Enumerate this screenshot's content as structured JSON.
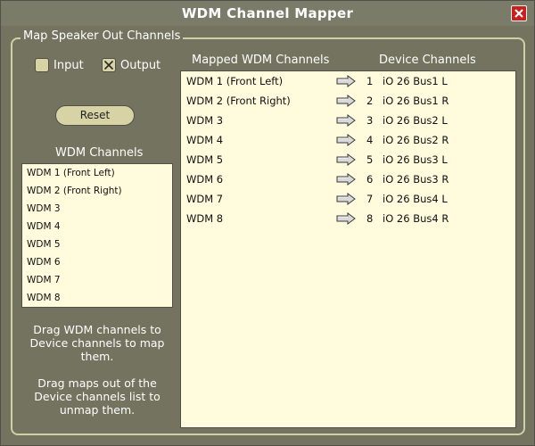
{
  "window": {
    "title": "WDM Channel Mapper"
  },
  "group": {
    "title": "Map Speaker Out Channels"
  },
  "direction": {
    "input_label": "Input",
    "output_label": "Output",
    "input_checked": false,
    "output_checked": true
  },
  "reset_label": "Reset",
  "wdm_channels": {
    "label": "WDM Channels",
    "items": [
      "WDM 1 (Front Left)",
      "WDM 2 (Front Right)",
      "WDM 3",
      "WDM 4",
      "WDM 5",
      "WDM 6",
      "WDM 7",
      "WDM 8"
    ]
  },
  "instructions": {
    "line1": "Drag WDM channels to Device channels to map them.",
    "line2": "Drag maps out of the Device channels list to unmap them."
  },
  "mappings": {
    "col_wdm": "Mapped WDM Channels",
    "col_device": "Device Channels",
    "rows": [
      {
        "wdm": "WDM 1 (Front Left)",
        "num": "1",
        "device": "iO 26 Bus1 L"
      },
      {
        "wdm": "WDM 2 (Front Right)",
        "num": "2",
        "device": "iO 26 Bus1 R"
      },
      {
        "wdm": "WDM 3",
        "num": "3",
        "device": "iO 26 Bus2 L"
      },
      {
        "wdm": "WDM 4",
        "num": "4",
        "device": "iO 26 Bus2 R"
      },
      {
        "wdm": "WDM 5",
        "num": "5",
        "device": "iO 26 Bus3 L"
      },
      {
        "wdm": "WDM 6",
        "num": "6",
        "device": "iO 26 Bus3 R"
      },
      {
        "wdm": "WDM 7",
        "num": "7",
        "device": "iO 26 Bus4 L"
      },
      {
        "wdm": "WDM 8",
        "num": "8",
        "device": "iO 26 Bus4 R"
      }
    ]
  },
  "colors": {
    "background": "#73735f",
    "list_bg": "#fffbdc",
    "accent": "#d8d3a4",
    "close": "#c8201c"
  },
  "icons": {
    "close": "close-icon",
    "check": "x-check-icon",
    "arrow": "right-arrow-icon"
  }
}
